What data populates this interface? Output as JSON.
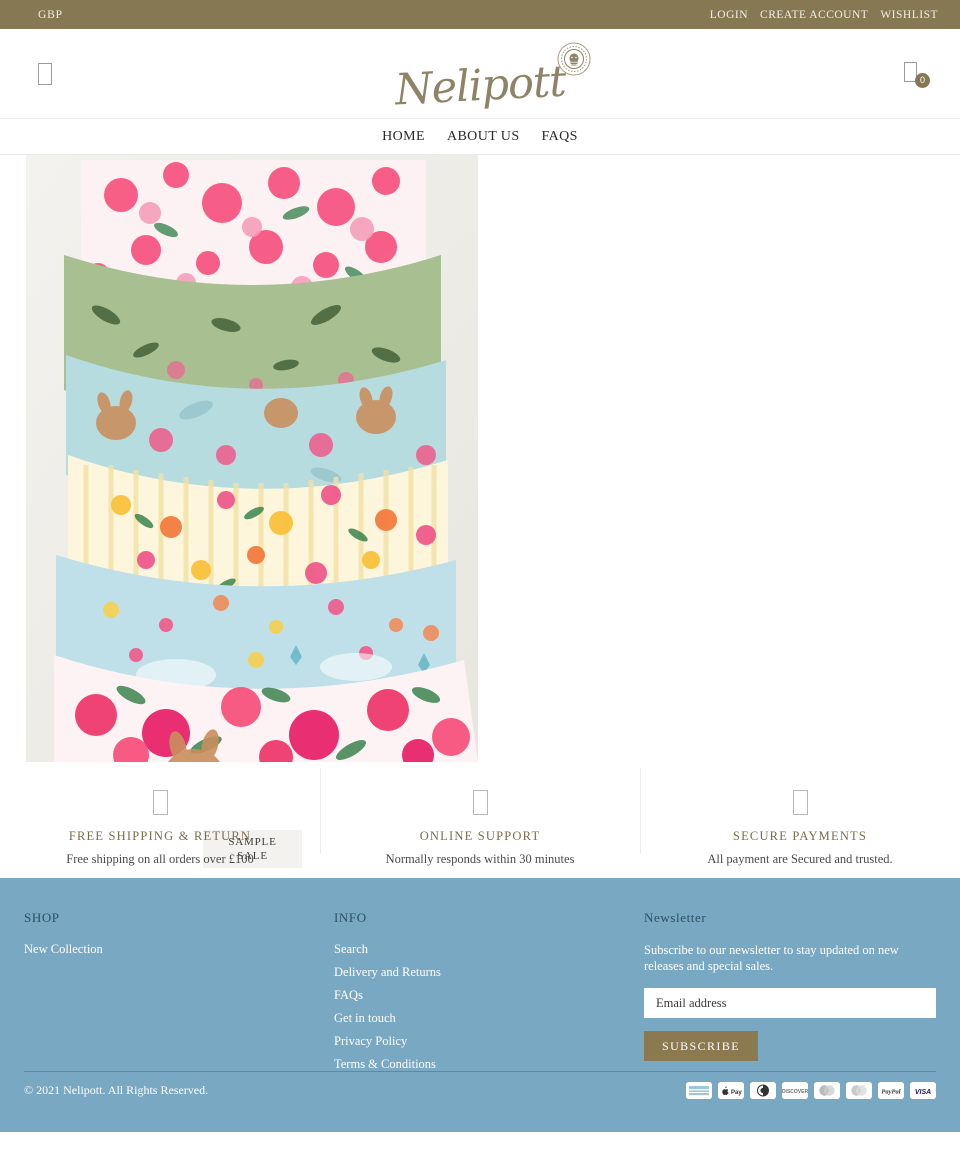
{
  "topbar": {
    "currency": "GBP",
    "links": [
      {
        "label": "LOGIN",
        "name": "login-link"
      },
      {
        "label": "CREATE ACCOUNT",
        "name": "create-account-link"
      },
      {
        "label": "WISHLIST",
        "name": "wishlist-link"
      }
    ]
  },
  "header": {
    "logo_text": "Nelipott",
    "menu_icon": "hamburger-menu-icon",
    "cart_icon": "shopping-bag-icon",
    "cart_count": "0",
    "badge_icon": "elephant-seal-badge-icon"
  },
  "nav": {
    "items": [
      {
        "label": "HOME",
        "name": "nav-home"
      },
      {
        "label": "ABOUT US",
        "name": "nav-about-us"
      },
      {
        "label": "FAQS",
        "name": "nav-faqs"
      }
    ]
  },
  "product": {
    "image_alt": "stack-of-floral-fabric-garments",
    "badge_line1": "SAMPLE",
    "badge_line2": "SALE"
  },
  "features": [
    {
      "icon": "truck-icon",
      "title": "FREE SHIPPING & RETURN",
      "subtitle": "Free shipping on all orders over £100"
    },
    {
      "icon": "headset-icon",
      "title": "ONLINE SUPPORT",
      "subtitle": "Normally responds within 30 minutes"
    },
    {
      "icon": "lock-icon",
      "title": "SECURE PAYMENTS",
      "subtitle": "All payment are Secured and trusted."
    }
  ],
  "footer": {
    "shop": {
      "heading": "SHOP",
      "links": [
        {
          "label": "New Collection"
        }
      ]
    },
    "info": {
      "heading": "INFO",
      "links": [
        {
          "label": "Search"
        },
        {
          "label": "Delivery and Returns"
        },
        {
          "label": "FAQs"
        },
        {
          "label": "Get in touch"
        },
        {
          "label": "Privacy Policy"
        },
        {
          "label": "Terms & Conditions"
        }
      ]
    },
    "newsletter": {
      "heading": "Newsletter",
      "description": "Subscribe to our newsletter to stay updated on new releases and special sales.",
      "placeholder": "Email address",
      "value": "",
      "button": "SUBSCRIBE"
    },
    "copyright": "© 2021 Nelipott. All Rights Reserved.",
    "payments": [
      {
        "name": "amex",
        "label": "AMEX"
      },
      {
        "name": "apple-pay",
        "label": "Pay"
      },
      {
        "name": "diners-club",
        "label": "DC"
      },
      {
        "name": "discover",
        "label": "DISC"
      },
      {
        "name": "maestro",
        "label": "MAE"
      },
      {
        "name": "mastercard",
        "label": "MC"
      },
      {
        "name": "paypal",
        "label": "PayPal"
      },
      {
        "name": "visa",
        "label": "VISA"
      }
    ]
  },
  "colors": {
    "topbar_bg": "#877854",
    "footer_bg": "#79a8c2",
    "accent_olive": "#8b7a4f",
    "feature_title": "#7a6c4d"
  }
}
